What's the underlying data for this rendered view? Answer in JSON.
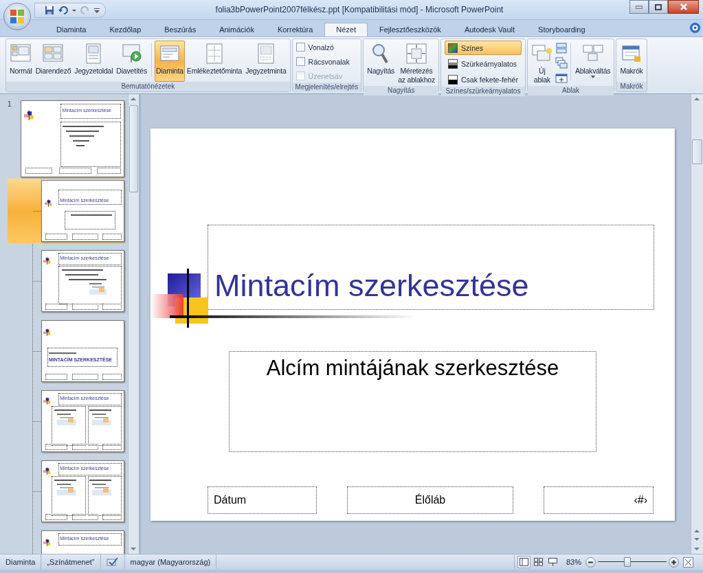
{
  "window": {
    "title": "folia3bPowerPoint2007félkész.ppt [Kompatibilitási mód] - Microsoft PowerPoint"
  },
  "tabs": [
    {
      "label": "Diaminta",
      "selected": false
    },
    {
      "label": "Kezdőlap",
      "selected": false
    },
    {
      "label": "Beszúrás",
      "selected": false
    },
    {
      "label": "Animációk",
      "selected": false
    },
    {
      "label": "Korrektúra",
      "selected": false
    },
    {
      "label": "Nézet",
      "selected": true
    },
    {
      "label": "Fejlesztőeszközök",
      "selected": false
    },
    {
      "label": "Autodesk Vault",
      "selected": false
    },
    {
      "label": "Storyboarding",
      "selected": false
    }
  ],
  "ribbon": {
    "groups": [
      {
        "label": "Bemutatónézetek",
        "items": [
          {
            "kind": "large",
            "label": "Normál",
            "selected": false
          },
          {
            "kind": "large",
            "label": "Diarendező",
            "selected": false
          },
          {
            "kind": "large",
            "label": "Jegyzetoldal",
            "selected": false
          },
          {
            "kind": "large",
            "label": "Diavetítés",
            "selected": false
          },
          {
            "kind": "separator"
          },
          {
            "kind": "large",
            "label": "Diaminta",
            "selected": true
          },
          {
            "kind": "large",
            "label": "Emlékeztetőminta",
            "selected": false
          },
          {
            "kind": "large",
            "label": "Jegyzetminta",
            "selected": false
          }
        ]
      },
      {
        "label": "Megjelenítés/elrejtés",
        "items": [
          {
            "kind": "check",
            "label": "Vonalzó",
            "checked": false,
            "disabled": false
          },
          {
            "kind": "check",
            "label": "Rácsvonalak",
            "checked": false,
            "disabled": false
          },
          {
            "kind": "check",
            "label": "Üzenetsáv",
            "checked": false,
            "disabled": true
          }
        ]
      },
      {
        "label": "Nagyítás",
        "items": [
          {
            "kind": "large",
            "label": "Nagyítás",
            "selected": false
          },
          {
            "kind": "large",
            "label": "Méretezés\naz ablakhoz",
            "selected": false
          }
        ]
      },
      {
        "label": "Színes/szürkeárnyalatos",
        "items": [
          {
            "kind": "option",
            "label": "Színes",
            "selected": true
          },
          {
            "kind": "option",
            "label": "Szürkeárnyalatos",
            "selected": false
          },
          {
            "kind": "option",
            "label": "Csak fekete-fehér",
            "selected": false
          }
        ]
      },
      {
        "label": "Ablak",
        "items": [
          {
            "kind": "large",
            "label": "Új\nablak",
            "selected": false
          },
          {
            "kind": "icon-stack"
          },
          {
            "kind": "separator"
          },
          {
            "kind": "dropdown",
            "label": "Ablakváltás"
          }
        ]
      },
      {
        "label": "Makrók",
        "items": [
          {
            "kind": "large",
            "label": "Makrók",
            "selected": false
          }
        ]
      }
    ]
  },
  "thumbnails": [
    {
      "number": "1",
      "kind": "master",
      "title": "Mintacím szerkesztése",
      "selected": false,
      "children": [
        {
          "kind": "title",
          "title": "Mintacím szerkesztése",
          "selected": true
        },
        {
          "kind": "content",
          "title": "Mintacím szerkesztése",
          "selected": false
        },
        {
          "kind": "section",
          "title": "MINTACÍM SZERKESZTÉSE",
          "selected": false
        },
        {
          "kind": "two",
          "title": "Mintacím szerkesztése",
          "selected": false
        },
        {
          "kind": "comparison",
          "title": "Mintacím szerkesztése",
          "selected": false
        },
        {
          "kind": "partial",
          "title": "Mintacím szerkesztése",
          "selected": false
        }
      ]
    }
  ],
  "slide": {
    "title": "Mintacím szerkesztése",
    "subtitle": "Alcím mintájának szerkesztése",
    "footers": [
      "Dátum",
      "Élőláb",
      "‹#›"
    ]
  },
  "status_bar": {
    "items": [
      {
        "kind": "text",
        "label": "Diaminta"
      },
      {
        "kind": "text",
        "label": "„Színátmenet”"
      },
      {
        "kind": "icon"
      },
      {
        "kind": "text",
        "label": "magyar (Magyarország)"
      }
    ],
    "views": [
      {
        "selected": true
      },
      {
        "selected": false
      },
      {
        "selected": false
      }
    ],
    "zoom": "83%",
    "zoom_slider": {
      "level": 0.43
    }
  }
}
